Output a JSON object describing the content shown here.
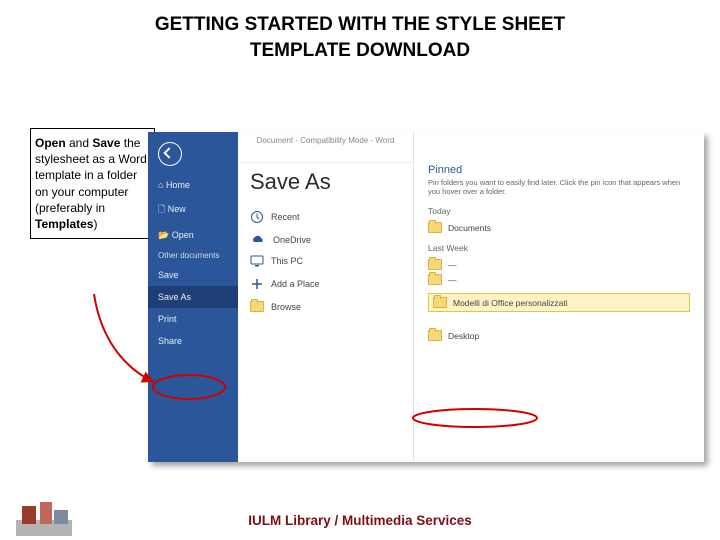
{
  "slide": {
    "title_l1": "GETTING STARTED WITH THE STYLE SHEET",
    "title_l2": "TEMPLATE DOWNLOAD",
    "footer": "IULM Library / Multimedia Services"
  },
  "callout": {
    "b1": "Open",
    "t1": " and ",
    "b2": "Save",
    "t2": " the stylesheet as a Word template in a folder on your computer (preferably in ",
    "b3": "Templates",
    "t3": ")"
  },
  "word": {
    "titlebar": "Document - Compatibility Mode - Word",
    "save_as": "Save As",
    "rail": {
      "home": "Home",
      "new": "New",
      "open": "Open",
      "other_docs": "Other documents",
      "save": "Save",
      "save_as": "Save As",
      "print": "Print",
      "share": "Share"
    },
    "locations": {
      "recent": "Recent",
      "onedrive": "OneDrive",
      "this_pc": "This PC",
      "add_place": "Add a Place",
      "browse": "Browse"
    },
    "right": {
      "pinned": "Pinned",
      "pinned_hint": "Pin folders you want to easily find later. Click the pin icon that appears when you hover over a folder.",
      "today": "Today",
      "documents": "Documents",
      "last_week": "Last Week",
      "templates": "Modelli di Office personalizzati",
      "desktop": "Desktop"
    }
  }
}
